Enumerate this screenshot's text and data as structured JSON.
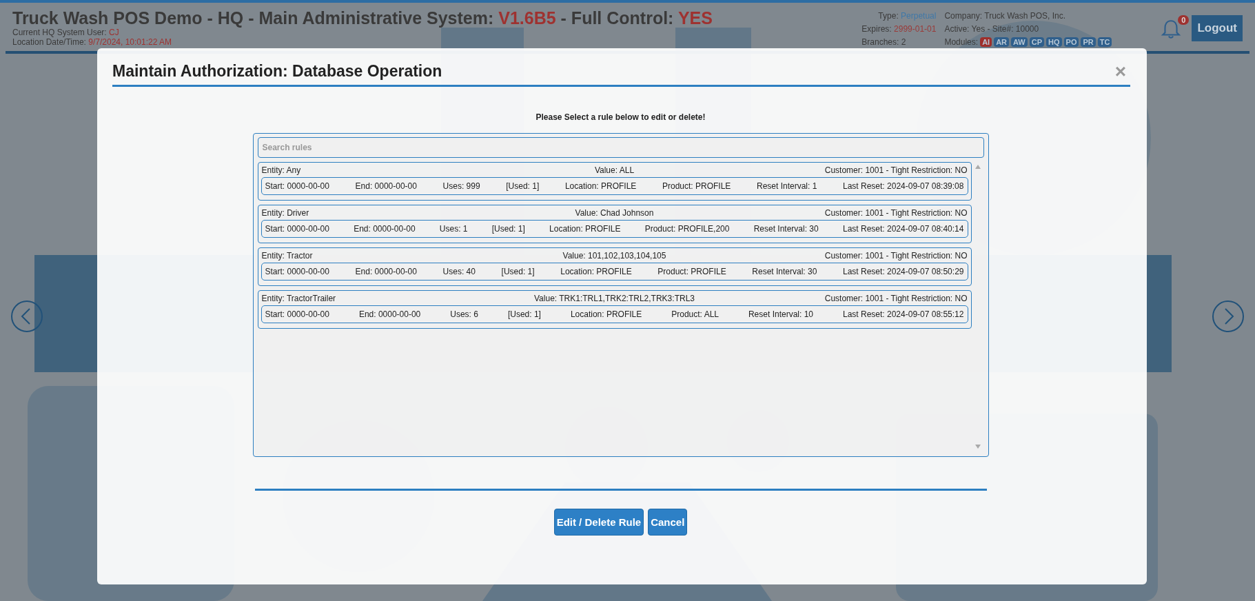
{
  "header": {
    "title_parts": [
      {
        "text": "Truck Wash POS Demo - HQ - Main Administrative System: ",
        "accent": false
      },
      {
        "text": "V1.6B5",
        "accent": true
      },
      {
        "text": " - Full Control: ",
        "accent": false
      },
      {
        "text": "YES",
        "accent": true
      }
    ],
    "user_label": "Current HQ System User:",
    "user_value": "CJ",
    "datetime_label": "Location Date/Time:",
    "datetime_value": "9/7/2024, 10:01:22 AM",
    "info": [
      {
        "label": "Type:",
        "value": "Perpetual",
        "color": "#3f78a8"
      },
      {
        "label": "Company:",
        "value": "Truck Wash POS, Inc.",
        "color": "#3a3a3a"
      },
      {
        "label": "Expires:",
        "value": "2999-01-01",
        "color": "#9a3a38"
      },
      {
        "label": "Active:",
        "value": "Yes - Site#: 10000",
        "color": "#3a3a3a"
      },
      {
        "label": "Branches:",
        "value": "2",
        "color": "#3a3a3a"
      }
    ],
    "modules_label": "Modules:",
    "modules": [
      {
        "label": "AI",
        "color": "#9e2f2c"
      },
      {
        "label": "AR",
        "color": "#2f5f8c"
      },
      {
        "label": "AW",
        "color": "#2f5f8c"
      },
      {
        "label": "CP",
        "color": "#2f5f8c"
      },
      {
        "label": "HQ",
        "color": "#2f5f8c"
      },
      {
        "label": "PO",
        "color": "#2f5f8c"
      },
      {
        "label": "PR",
        "color": "#2f5f8c"
      },
      {
        "label": "TC",
        "color": "#2f5f8c"
      }
    ],
    "notifications": "0",
    "logout": "Logout"
  },
  "modal": {
    "title": "Maintain Authorization: Database Operation",
    "close": "×",
    "instruction": "Please Select a rule below to edit or delete!",
    "search": {
      "placeholder": "Search rules"
    },
    "rules": [
      {
        "entity": "Entity: Any",
        "value": "Value: ALL",
        "customer": "Customer: 1001 - Tight Restriction: NO",
        "fields": [
          "Start: 0000-00-00",
          "End: 0000-00-00",
          "Uses: 999",
          "[Used: 1]",
          "Location: PROFILE",
          "Product: PROFILE",
          "Reset Interval: 1",
          "Last Reset: 2024-09-07 08:39:08"
        ]
      },
      {
        "entity": "Entity: Driver",
        "value": "Value: Chad Johnson",
        "customer": "Customer: 1001 - Tight Restriction: NO",
        "fields": [
          "Start: 0000-00-00",
          "End: 0000-00-00",
          "Uses: 1",
          "[Used: 1]",
          "Location: PROFILE",
          "Product: PROFILE,200",
          "Reset Interval: 30",
          "Last Reset: 2024-09-07 08:40:14"
        ]
      },
      {
        "entity": "Entity: Tractor",
        "value": "Value: 101,102,103,104,105",
        "customer": "Customer: 1001 - Tight Restriction: NO",
        "fields": [
          "Start: 0000-00-00",
          "End: 0000-00-00",
          "Uses: 40",
          "[Used: 1]",
          "Location: PROFILE",
          "Product: PROFILE",
          "Reset Interval: 30",
          "Last Reset: 2024-09-07 08:50:29"
        ]
      },
      {
        "entity": "Entity: TractorTrailer",
        "value": "Value: TRK1:TRL1,TRK2:TRL2,TRK3:TRL3",
        "customer": "Customer: 1001 - Tight Restriction: NO",
        "fields": [
          "Start: 0000-00-00",
          "End: 0000-00-00",
          "Uses: 6",
          "[Used: 1]",
          "Location: PROFILE",
          "Product: ALL",
          "Reset Interval: 10",
          "Last Reset: 2024-09-07 08:55:12"
        ]
      }
    ],
    "buttons": [
      "Edit / Delete Rule",
      "Cancel"
    ]
  }
}
